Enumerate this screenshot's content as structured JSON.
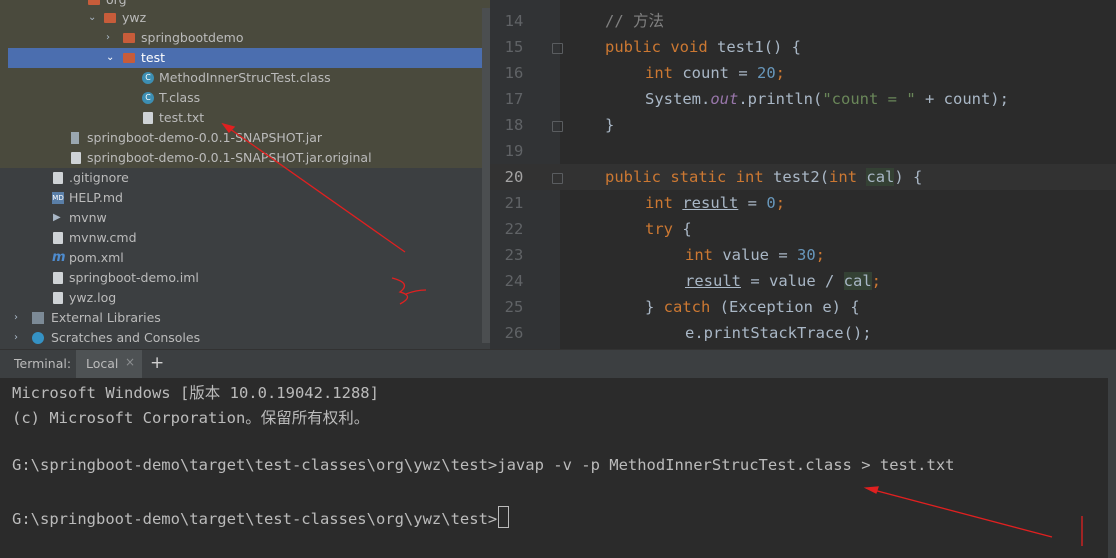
{
  "tree": {
    "partial_label": "org",
    "items": [
      {
        "label": "ywz"
      },
      {
        "label": "springbootdemo"
      },
      {
        "label": "test"
      },
      {
        "label": "MethodInnerStrucTest.class"
      },
      {
        "label": "T.class"
      },
      {
        "label": "test.txt"
      },
      {
        "label": "springboot-demo-0.0.1-SNAPSHOT.jar"
      },
      {
        "label": "springboot-demo-0.0.1-SNAPSHOT.jar.original"
      },
      {
        "label": ".gitignore"
      },
      {
        "label": "HELP.md"
      },
      {
        "label": "mvnw"
      },
      {
        "label": "mvnw.cmd"
      },
      {
        "label": "pom.xml"
      },
      {
        "label": "springboot-demo.iml"
      },
      {
        "label": "ywz.log"
      },
      {
        "label": "External Libraries"
      },
      {
        "label": "Scratches and Consoles"
      }
    ]
  },
  "editor": {
    "line_numbers": [
      "14",
      "15",
      "16",
      "17",
      "18",
      "19",
      "20",
      "21",
      "22",
      "23",
      "24",
      "25",
      "26"
    ],
    "current_line": "20",
    "code": {
      "l14": {
        "comment": "// 方法"
      },
      "l15": {
        "kw1": "public",
        "kw2": "void",
        "name": "test1",
        "rest": "() {"
      },
      "l16": {
        "kw": "int",
        "var": " count = ",
        "num": "20",
        ";": ";"
      },
      "l17": {
        "pre": "System.",
        "field": "out",
        "mid": ".println(",
        "str": "\"count = \"",
        "post": " + count);"
      },
      "l18": {
        "text": "}"
      },
      "l20": {
        "kw1": "public",
        "kw2": "static",
        "kw3": "int",
        "name": "test2",
        "p1": "(",
        "kw4": "int",
        "param": "cal",
        "post": ") {"
      },
      "l21": {
        "kw": "int",
        "var": "result",
        "eq": " = ",
        "num": "0",
        ";": ";"
      },
      "l22": {
        "kw": "try",
        "post": " {"
      },
      "l23": {
        "kw": "int",
        "var": " value = ",
        "num": "30",
        ";": ";"
      },
      "l24": {
        "var": "result",
        "mid": " = value / ",
        "param": "cal",
        ";": ";"
      },
      "l25": {
        "pre": "} ",
        "kw": "catch",
        "post": " (Exception e) {"
      },
      "l26": {
        "text": "e.printStackTrace();"
      }
    }
  },
  "terminal": {
    "title": "Terminal:",
    "tab_label": "Local",
    "tab_close": "×",
    "add_tab": "+",
    "lines": [
      "Microsoft Windows [版本 10.0.19042.1288]",
      "(c) Microsoft Corporation。保留所有权利。",
      "G:\\springboot-demo\\target\\test-classes\\org\\ywz\\test>javap -v -p MethodInnerStrucTest.class > test.txt",
      "G:\\springboot-demo\\target\\test-classes\\org\\ywz\\test>"
    ]
  },
  "colors": {
    "annotation": "#e02020",
    "selection": "#4b6eaf",
    "keyword": "#cc7832",
    "number": "#6897bb",
    "string": "#6a8759"
  },
  "icons": [
    "folder-icon",
    "class-icon",
    "text-file-icon",
    "jar-icon",
    "markdown-icon",
    "maven-icon",
    "library-icon",
    "scratches-icon",
    "chevron-right-icon",
    "chevron-down-icon",
    "plus-icon",
    "close-icon"
  ]
}
